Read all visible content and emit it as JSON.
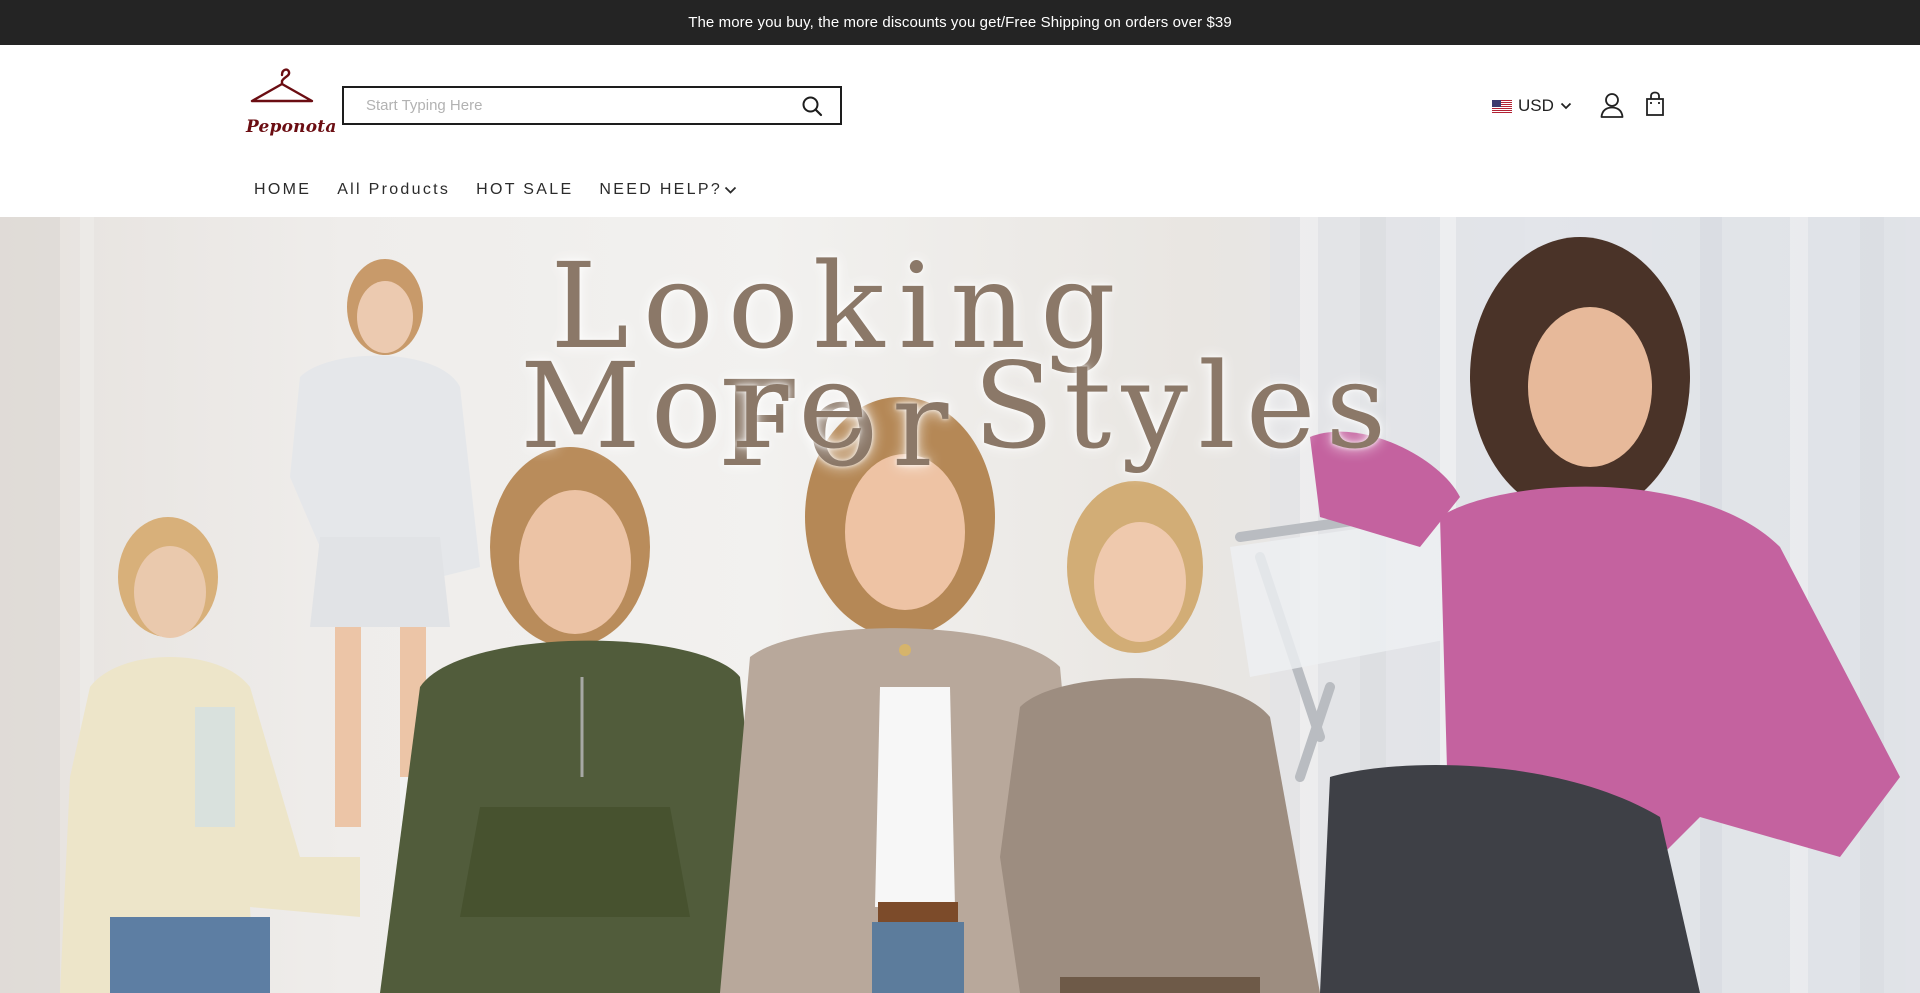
{
  "announcement": {
    "text": "The more you buy, the more discounts you get/Free Shipping on orders over $39"
  },
  "header": {
    "logo_text": "Peponota",
    "logo_icon": "clothes-hanger-icon",
    "search": {
      "placeholder": "Start Typing Here",
      "value": "",
      "icon": "search-icon"
    },
    "currency": {
      "label": "USD",
      "flag": "us-flag-icon"
    },
    "account_icon": "user-icon",
    "cart_icon": "shopping-bag-icon"
  },
  "nav": {
    "items": [
      {
        "label": "HOME"
      },
      {
        "label": "All Products"
      },
      {
        "label": "HOT SALE"
      },
      {
        "label": "NEED HELP?",
        "has_dropdown": true
      }
    ]
  },
  "hero": {
    "line1": "Looking For",
    "line2": "More  Styles",
    "image": "models-wearing-sweaters-hoodies-jackets"
  },
  "colors": {
    "announcement_bg": "#242424",
    "brand": "#6b0d12",
    "hero_text": "#8b7868"
  }
}
